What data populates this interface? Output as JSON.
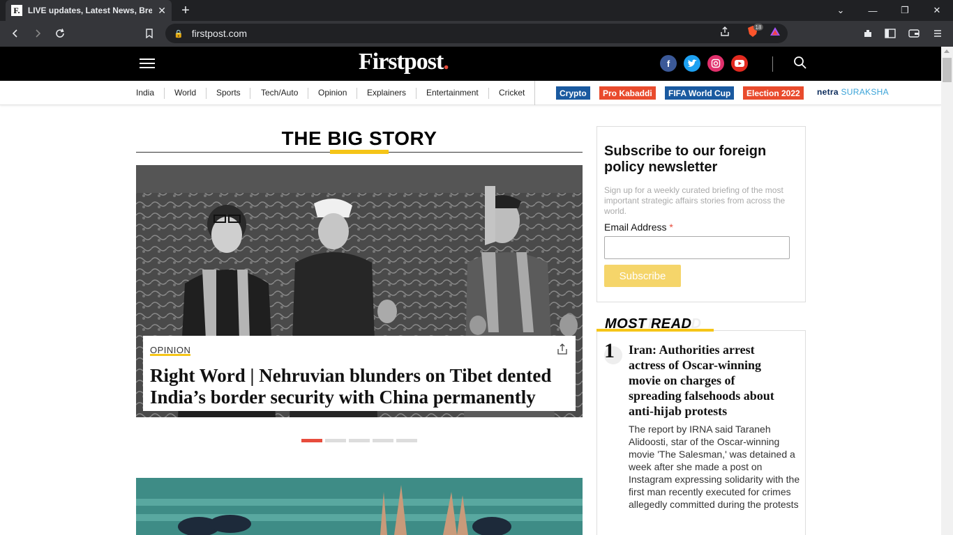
{
  "browser": {
    "tab_favicon": "F.",
    "tab_title": "LIVE updates, Latest News, Breaking",
    "tab_close": "✕",
    "new_tab": "+",
    "url": "firstpost.com",
    "extension_badge": "18"
  },
  "site": {
    "logo_text": "Firstpost",
    "logo_dot": ".",
    "social": [
      {
        "name": "facebook",
        "glyph": "f",
        "color": "#3b5998"
      },
      {
        "name": "twitter",
        "glyph": "t",
        "color": "#1da1f2"
      },
      {
        "name": "instagram",
        "glyph": "◎",
        "color": "#e1306c"
      },
      {
        "name": "youtube",
        "glyph": "▶",
        "color": "#ff0000"
      }
    ]
  },
  "nav": {
    "items": [
      "India",
      "World",
      "Sports",
      "Tech/Auto",
      "Opinion",
      "Explainers",
      "Entertainment",
      "Cricket"
    ],
    "badges": [
      {
        "label": "Crypto",
        "color": "#1a5aa0"
      },
      {
        "label": "Pro Kabaddi",
        "color": "#e94b2d"
      },
      {
        "label": "FIFA World Cup",
        "color": "#1a5aa0"
      },
      {
        "label": "Election 2022",
        "color": "#e94b2d"
      }
    ],
    "netra_prefix": "netra",
    "netra_suffix": "SURAKSHA"
  },
  "big_story": {
    "section_title": "THE BIG STORY",
    "category": "OPINION",
    "headline": "Right Word | Nehruvian blunders on Tibet dented India’s border security with China permanently",
    "slides_total": 5,
    "active_slide": 1
  },
  "newsletter": {
    "title": "Subscribe to our foreign policy newsletter",
    "description": "Sign up for a weekly curated briefing of the most important strategic affairs stories from across the world.",
    "email_label": "Email Address",
    "required_mark": "*",
    "email_value": "",
    "button_label": "Subscribe"
  },
  "most_read": {
    "title": "MOST READ",
    "ghost_title": "MOST READ",
    "items": [
      {
        "rank": "1",
        "headline": "Iran: Authorities arrest actress of Oscar-winning movie on charges of spreading falsehoods about anti-hijab protests",
        "summary": "The report by IRNA said Taraneh Alidoosti, star of the Oscar-winning movie 'The Salesman,' was detained a week after she made a post on Instagram expressing solidarity with the first man recently executed for crimes allegedly committed during the protests"
      }
    ]
  }
}
